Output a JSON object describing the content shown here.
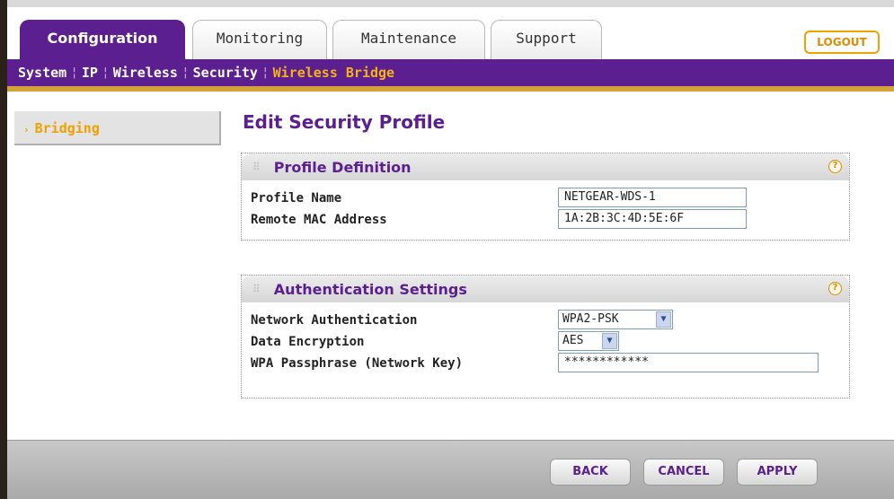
{
  "tabs": [
    {
      "label": "Configuration",
      "active": true
    },
    {
      "label": "Monitoring",
      "active": false
    },
    {
      "label": "Maintenance",
      "active": false
    },
    {
      "label": "Support",
      "active": false
    }
  ],
  "logout_label": "LOGOUT",
  "submenu": {
    "items": [
      "System",
      "IP",
      "Wireless",
      "Security",
      "Wireless Bridge"
    ],
    "active": "Wireless Bridge"
  },
  "sidebar": {
    "items": [
      {
        "label": "Bridging",
        "icon": "chevron-right-icon"
      }
    ]
  },
  "page_title": "Edit Security Profile",
  "profile_definition": {
    "title": "Profile Definition",
    "profile_name_label": "Profile Name",
    "profile_name_value": "NETGEAR-WDS-1",
    "remote_mac_label": "Remote MAC Address",
    "remote_mac_value": "1A:2B:3C:4D:5E:6F"
  },
  "authentication_settings": {
    "title": "Authentication Settings",
    "network_auth_label": "Network Authentication",
    "network_auth_value": "WPA2-PSK",
    "data_encryption_label": "Data Encryption",
    "data_encryption_value": "AES",
    "passphrase_label": "WPA Passphrase (Network Key)",
    "passphrase_value": "************"
  },
  "help_glyph": "?",
  "buttons": {
    "back": "BACK",
    "cancel": "CANCEL",
    "apply": "APPLY"
  },
  "colors": {
    "brand_purple": "#5b1f8f",
    "accent_orange": "#f0a100"
  }
}
